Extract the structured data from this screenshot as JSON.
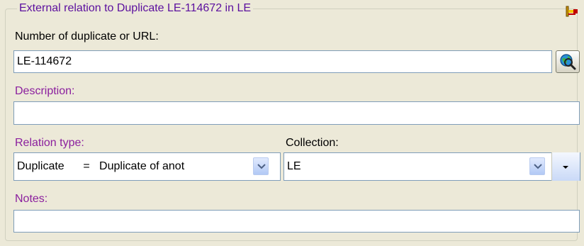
{
  "group": {
    "title": "External relation to Duplicate LE-114672 in LE"
  },
  "number": {
    "label": "Number of duplicate or URL:",
    "value": "LE-114672"
  },
  "description": {
    "label": "Description:",
    "value": ""
  },
  "relation_type": {
    "label": "Relation type:",
    "value": "Duplicate      =   Duplicate of anot"
  },
  "collection": {
    "label": "Collection:",
    "value": "LE"
  },
  "notes": {
    "label": "Notes:",
    "value": ""
  },
  "icons": {
    "corner": "relation-connector-icon",
    "search": "web-search-globe-icon",
    "dropdown": "chevron-down-icon"
  },
  "colors": {
    "window_bg": "#ECE9D8",
    "group_title": "#5B0F9E",
    "label_purple": "#8B1F9E",
    "field_border": "#7F9DB9"
  }
}
